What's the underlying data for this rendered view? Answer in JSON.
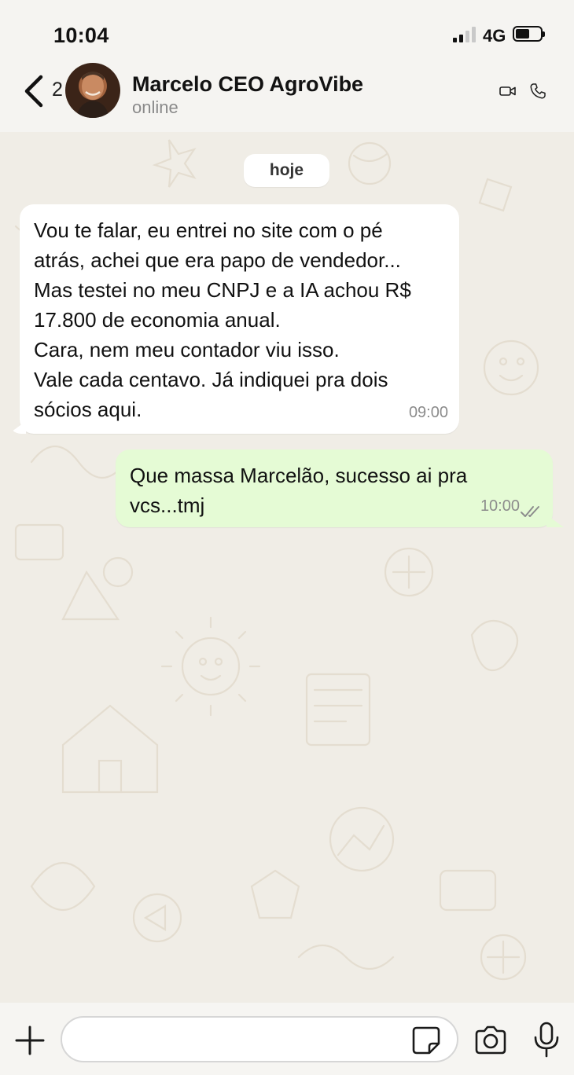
{
  "status_bar": {
    "time": "10:04",
    "network": "4G",
    "signal_bars": 2,
    "battery_level": 0.55
  },
  "header": {
    "unread_count": "2",
    "contact_name": "Marcelo CEO AgroVibe",
    "contact_status": "online",
    "icons": [
      "back-chevron-icon",
      "video-call-icon",
      "phone-call-icon"
    ]
  },
  "chat": {
    "date_chip": "hoje",
    "messages": [
      {
        "direction": "incoming",
        "lines": [
          "Vou te falar, eu entrei no site com o pé",
          "atrás, achei que era papo de vendedor...",
          "Mas testei no meu CNPJ e a IA achou R$",
          "17.800 de economia anual.",
          "Cara, nem meu contador viu isso.",
          "Vale cada centavo. Já indiquei pra dois",
          "sócios aqui."
        ],
        "time": "09:00"
      },
      {
        "direction": "outgoing",
        "lines": [
          "Que massa Marcelão, sucesso ai pra",
          "vcs...tmj"
        ],
        "time": "10:00",
        "read_receipt": "double-check"
      }
    ]
  },
  "input_bar": {
    "placeholder": "",
    "value": "",
    "icons": [
      "plus-icon",
      "sticker-icon",
      "camera-icon",
      "microphone-icon"
    ]
  },
  "colors": {
    "incoming_bubble": "#ffffff",
    "outgoing_bubble": "#e5fbd5",
    "chat_background": "#f0ede6",
    "timestamp": "#8c8c8c"
  }
}
